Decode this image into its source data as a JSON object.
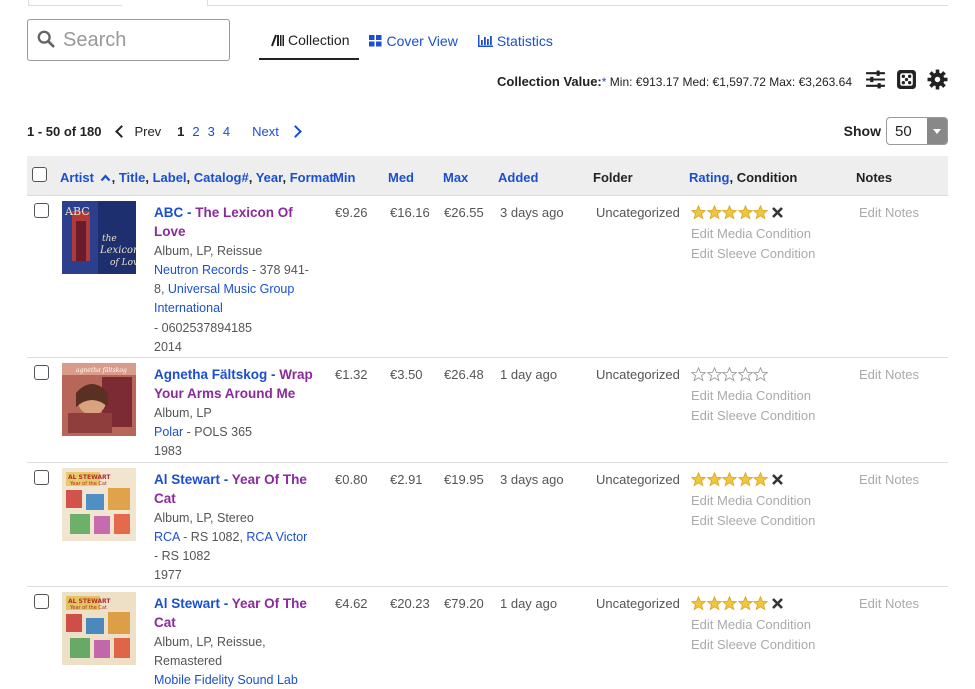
{
  "search": {
    "placeholder": "Search"
  },
  "views": [
    {
      "label": "Collection",
      "active": true
    },
    {
      "label": "Cover View",
      "active": false
    },
    {
      "label": "Statistics",
      "active": false
    }
  ],
  "collection_value": {
    "label": "Collection Value:",
    "asterisk": "*",
    "min": "Min: €913.17",
    "med": "Med: €1,597.72",
    "max": "Max: €3,263.64"
  },
  "pager": {
    "range": "1 - 50 of 180",
    "prev": "Prev",
    "pages": [
      "1",
      "2",
      "3",
      "4"
    ],
    "current": "1",
    "next": "Next"
  },
  "show": {
    "label": "Show",
    "value": "50"
  },
  "columns": {
    "artist": "Artist",
    "title": "Title",
    "label": "Label",
    "catalog": "Catalog#",
    "year": "Year",
    "format": "Format",
    "comma": ",",
    "min": "Min",
    "med": "Med",
    "max": "Max",
    "added": "Added",
    "folder": "Folder",
    "rating": "Rating",
    "condition": "Condition",
    "notes": "Notes"
  },
  "rows": [
    {
      "artist": "ABC",
      "album": "The Lexicon Of Love",
      "format": "Album, LP, Reissue",
      "label_line1_link": "Neutron Records",
      "label_line1_rest": " - 378 941-",
      "label_line2": "8, ",
      "label_line2_link": "Universal Music Group International",
      "catalog": "- 0602537894185",
      "year": "2014",
      "min": "€9.26",
      "med": "€16.16",
      "max": "€26.55",
      "added": "3 days ago",
      "folder": "Uncategorized",
      "rating": 5,
      "media_condition": "Edit Media Condition",
      "sleeve_condition": "Edit Sleeve Condition",
      "notes": "Edit Notes"
    },
    {
      "artist": "Agnetha Fältskog",
      "album": "Wrap Your Arms Around Me",
      "format": "Album, LP",
      "label_link": "Polar",
      "label_rest": " - POLS 365",
      "year": "1983",
      "min": "€1.32",
      "med": "€3.50",
      "max": "€26.48",
      "added": "1 day ago",
      "folder": "Uncategorized",
      "rating": 0,
      "media_condition": "Edit Media Condition",
      "sleeve_condition": "Edit Sleeve Condition",
      "notes": "Edit Notes"
    },
    {
      "artist": "Al Stewart",
      "album": "Year Of The Cat",
      "format": "Album, LP, Stereo",
      "label_link": "RCA",
      "label_rest": " - RS 1082, ",
      "label_link2": "RCA Victor",
      "catalog": "- RS 1082",
      "year": "1977",
      "min": "€0.80",
      "med": "€2.91",
      "max": "€19.95",
      "added": "3 days ago",
      "folder": "Uncategorized",
      "rating": 5,
      "media_condition": "Edit Media Condition",
      "sleeve_condition": "Edit Sleeve Condition",
      "notes": "Edit Notes"
    },
    {
      "artist": "Al Stewart",
      "album": "Year Of The Cat",
      "format": "Album, LP, Reissue, Remastered",
      "label_link": "Mobile Fidelity Sound Lab",
      "min": "€4.62",
      "med": "€20.23",
      "max": "€79.20",
      "added": "1 day ago",
      "folder": "Uncategorized",
      "rating": 5,
      "media_condition": "Edit Media Condition",
      "sleeve_condition": "Edit Sleeve Condition",
      "notes": "Edit Notes"
    }
  ],
  "icons": {
    "search": "search-icon",
    "collection": "list-view-icon",
    "cover": "grid-view-icon",
    "stats": "bar-chart-icon",
    "filters": "sliders-icon",
    "random": "dice-icon",
    "settings": "gear-icon",
    "sort": "chevron-up-icon",
    "star": "star-icon",
    "clear": "clear-rating-icon"
  },
  "colors": {
    "link": "#1b4fd1",
    "album": "#8a2a9c",
    "star": "#f2c53d"
  }
}
